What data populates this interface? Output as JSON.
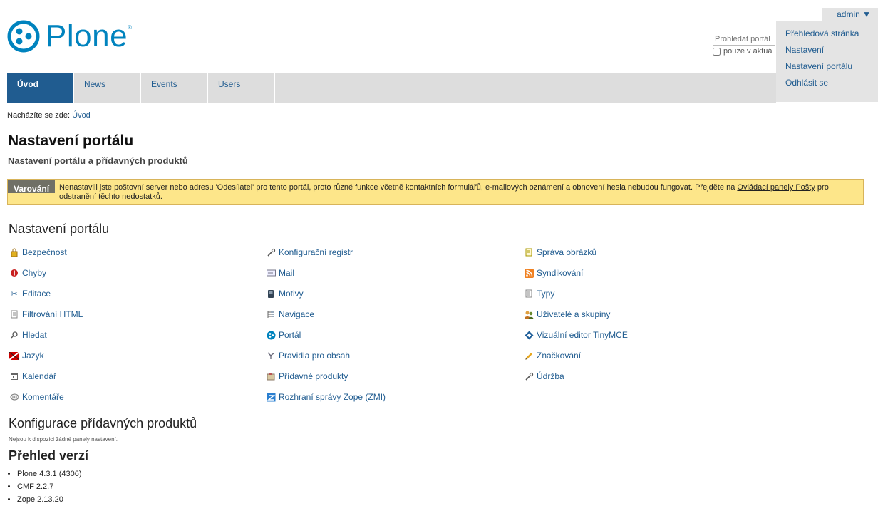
{
  "header": {
    "logo_text": "Plone",
    "logo_mark": "®",
    "search_placeholder": "Prohledat portál",
    "search_scope_label": "pouze v aktuá",
    "user_label": "admin ▼",
    "user_menu": [
      "Přehledová stránka",
      "Nastavení",
      "Nastavení portálu",
      "Odhlásit se"
    ]
  },
  "nav": {
    "tabs": [
      {
        "label": "Úvod",
        "active": true
      },
      {
        "label": "News",
        "active": false
      },
      {
        "label": "Events",
        "active": false
      },
      {
        "label": "Users",
        "active": false
      }
    ]
  },
  "breadcrumb": {
    "prefix": "Nacházíte se zde:",
    "link": "Úvod"
  },
  "page": {
    "title": "Nastavení portálu",
    "subtitle": "Nastavení portálu a přídavných produktů"
  },
  "warning": {
    "tag": "Varování",
    "text_before": "Nenastavili jste poštovní server nebo adresu 'Odesílatel' pro tento portál, proto různé funkce včetně kontaktních formulářů, e-mailových oznámení a obnovení hesla nebudou fungovat. Přejděte na ",
    "link": "Ovládací panely Pošty",
    "text_after": " pro odstranění těchto nedostatků."
  },
  "section_settings": {
    "heading": "Nastavení portálu",
    "col1": [
      {
        "label": "Bezpečnost",
        "icon": "lock-icon"
      },
      {
        "label": "Chyby",
        "icon": "error-icon"
      },
      {
        "label": "Editace",
        "icon": "scissors-icon"
      },
      {
        "label": "Filtrování HTML",
        "icon": "document-icon"
      },
      {
        "label": "Hledat",
        "icon": "search-icon"
      },
      {
        "label": "Jazyk",
        "icon": "language-flag-icon"
      },
      {
        "label": "Kalendář",
        "icon": "calendar-icon"
      },
      {
        "label": "Komentáře",
        "icon": "comment-icon"
      }
    ],
    "col2": [
      {
        "label": "Konfigurační registr",
        "icon": "wrench-icon"
      },
      {
        "label": "Mail",
        "icon": "mail-icon"
      },
      {
        "label": "Motivy",
        "icon": "theme-icon"
      },
      {
        "label": "Navigace",
        "icon": "navigation-icon"
      },
      {
        "label": "Portál",
        "icon": "plone-logo-icon"
      },
      {
        "label": "Pravidla pro obsah",
        "icon": "rules-icon"
      },
      {
        "label": "Přídavné produkty",
        "icon": "addons-icon"
      },
      {
        "label": "Rozhraní správy Zope (ZMI)",
        "icon": "zope-icon"
      }
    ],
    "col3": [
      {
        "label": "Správa obrázků",
        "icon": "image-icon"
      },
      {
        "label": "Syndikování",
        "icon": "rss-icon"
      },
      {
        "label": "Typy",
        "icon": "types-icon"
      },
      {
        "label": "Uživatelé a skupiny",
        "icon": "users-icon"
      },
      {
        "label": "Vizuální editor TinyMCE",
        "icon": "tinymce-icon"
      },
      {
        "label": "Značkování",
        "icon": "pencil-icon"
      },
      {
        "label": "Údržba",
        "icon": "wrench-icon"
      }
    ]
  },
  "section_addons": {
    "heading": "Konfigurace přídavných produktů",
    "note": "Nejsou k dispozici žádné panely nastavení."
  },
  "section_versions": {
    "heading": "Přehled verzí",
    "items": [
      "Plone 4.3.1 (4306)",
      "CMF 2.2.7",
      "Zope 2.13.20"
    ]
  },
  "colors": {
    "accent": "#205c90",
    "logo": "#0083be",
    "warning_bg": "#fde68a"
  }
}
